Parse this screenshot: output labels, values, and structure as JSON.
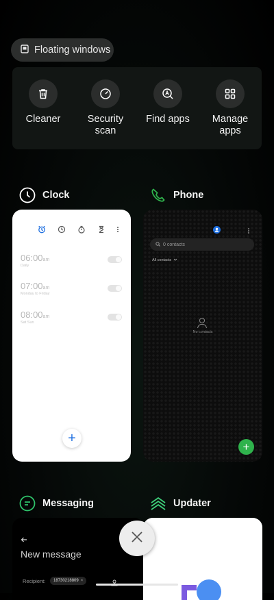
{
  "floating_windows": {
    "label": "Floating windows",
    "icon": "floating-window-icon"
  },
  "quick_actions": [
    {
      "label": "Cleaner",
      "icon": "trash-icon"
    },
    {
      "label": "Security\nscan",
      "icon": "security-scan-icon"
    },
    {
      "label": "Find apps",
      "icon": "find-apps-icon"
    },
    {
      "label": "Manage\napps",
      "icon": "grid-apps-icon"
    }
  ],
  "apps": {
    "clock": {
      "title": "Clock",
      "alarms": [
        {
          "time": "06:00",
          "ampm": "am",
          "repeat": "Daily"
        },
        {
          "time": "07:00",
          "ampm": "am",
          "repeat": "Monday to Friday"
        },
        {
          "time": "08:00",
          "ampm": "am",
          "repeat": "Sat Sun"
        }
      ],
      "fab": "+"
    },
    "phone": {
      "title": "Phone",
      "search_placeholder": "0 contacts",
      "filter": "All contacts",
      "empty": "No contacts",
      "fab": "+"
    },
    "messaging": {
      "title": "Messaging",
      "heading": "New message",
      "recipient_label": "Recipient:",
      "recipient_value": "18730218809"
    },
    "updater": {
      "title": "Updater"
    }
  },
  "colors": {
    "accent_blue": "#1e6fe0",
    "fab_green": "#2fb24c",
    "messaging_green": "#2ec26a",
    "updater_green": "#3ecf7a"
  }
}
